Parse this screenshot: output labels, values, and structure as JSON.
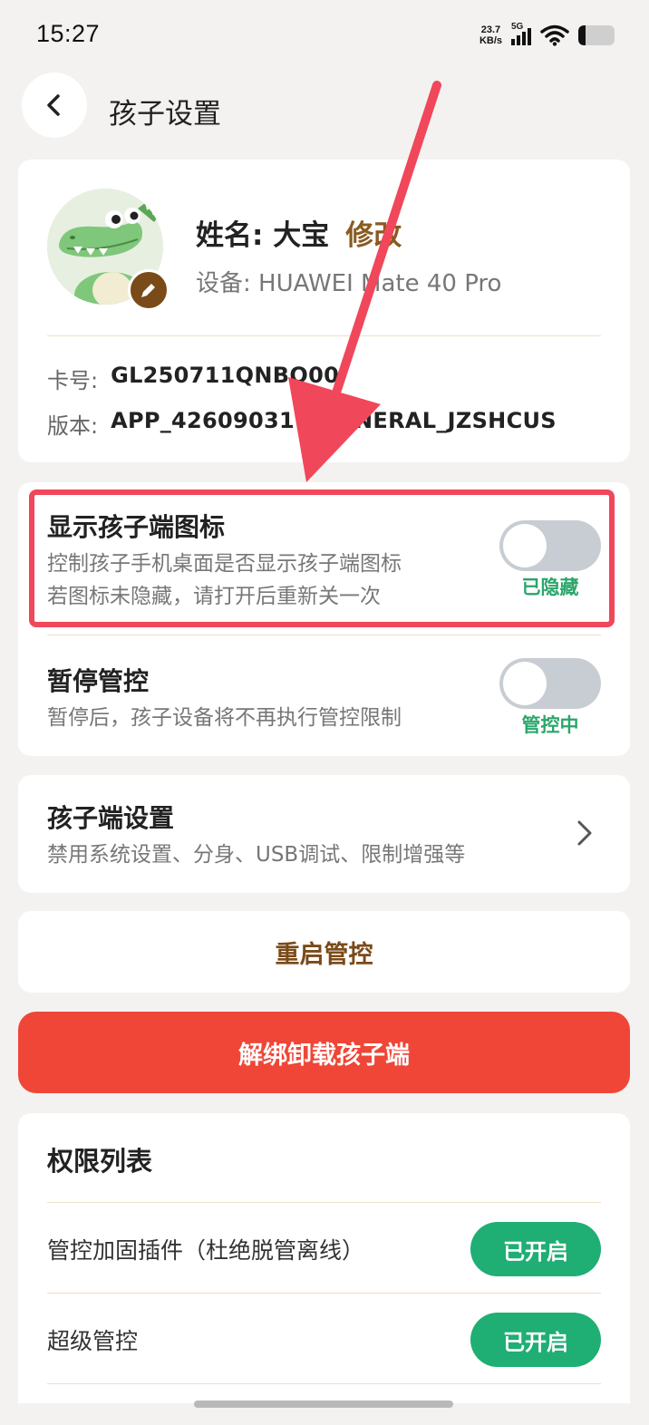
{
  "status_bar": {
    "time": "15:27",
    "net_speed_value": "23.7",
    "net_speed_unit": "KB/s",
    "network_type": "5G",
    "signal_level": 4,
    "battery_level": 0.2
  },
  "header": {
    "title": "孩子设置",
    "back_icon": "chevron-left-icon"
  },
  "profile": {
    "name_label": "姓名: 大宝",
    "modify_label": "修改",
    "device_label": "设备: HUAWEI Mate 40 Pro",
    "card_label": "卡号:",
    "card_value": "GL250711QNBQ00",
    "version_label": "版本:",
    "version_value": "APP_426090311_GENERAL_JZSHCUS",
    "avatar_icon": "crocodile-avatar",
    "edit_icon": "pencil-icon"
  },
  "toggles": [
    {
      "title": "显示孩子端图标",
      "desc_line1": "控制孩子手机桌面是否显示孩子端图标",
      "desc_line2": "若图标未隐藏，请打开后重新关一次",
      "status": "已隐藏",
      "on": false
    },
    {
      "title": "暂停管控",
      "desc_line1": "暂停后，孩子设备将不再执行管控限制",
      "status": "管控中",
      "on": false
    }
  ],
  "child_settings": {
    "title": "孩子端设置",
    "desc": "禁用系统设置、分身、USB调试、限制增强等",
    "chevron_icon": "chevron-right-icon"
  },
  "restart": {
    "label": "重启管控"
  },
  "unbind": {
    "label": "解绑卸载孩子端"
  },
  "permissions": {
    "title": "权限列表",
    "items": [
      {
        "name": "管控加固插件（杜绝脱管离线）",
        "status": "已开启"
      },
      {
        "name": "超级管控",
        "status": "已开启"
      }
    ]
  },
  "colors": {
    "accent_brown": "#7a4a19",
    "danger_red": "#ef4637",
    "success_green": "#1fae74",
    "annotation_red": "#f0475a"
  }
}
